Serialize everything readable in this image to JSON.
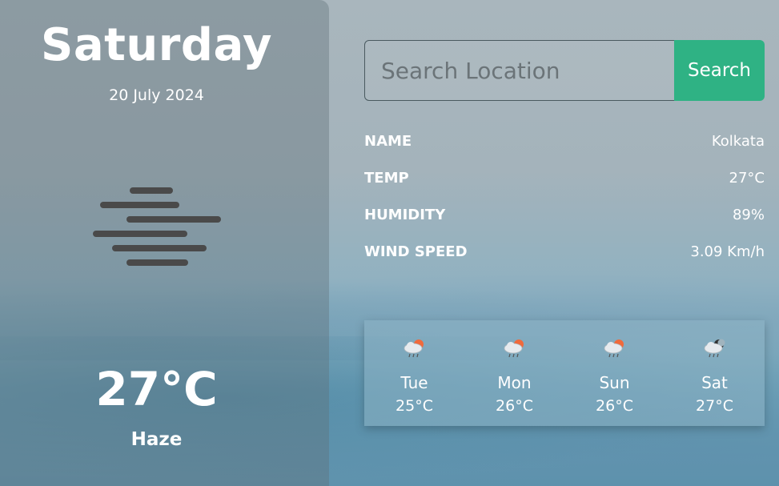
{
  "current": {
    "day": "Saturday",
    "date": "20 July 2024",
    "weather_icon": "haze-icon",
    "temperature": "27°C",
    "condition": "Haze"
  },
  "search": {
    "placeholder": "Search Location",
    "value": "",
    "button_label": "Search"
  },
  "details": [
    {
      "label": "NAME",
      "value": "Kolkata"
    },
    {
      "label": "TEMP",
      "value": "27°C"
    },
    {
      "label": "HUMIDITY",
      "value": "89%"
    },
    {
      "label": "WIND SPEED",
      "value": "3.09 Km/h"
    }
  ],
  "forecast": [
    {
      "day": "Tue",
      "temp": "25°C",
      "icon": "rain-sun-cloud-icon"
    },
    {
      "day": "Mon",
      "temp": "26°C",
      "icon": "rain-sun-cloud-icon"
    },
    {
      "day": "Sun",
      "temp": "26°C",
      "icon": "rain-sun-cloud-icon"
    },
    {
      "day": "Sat",
      "temp": "27°C",
      "icon": "rain-moon-cloud-icon"
    }
  ],
  "colors": {
    "accent": "#2fb284",
    "sun": "#f06a3c",
    "moon": "#333333"
  }
}
